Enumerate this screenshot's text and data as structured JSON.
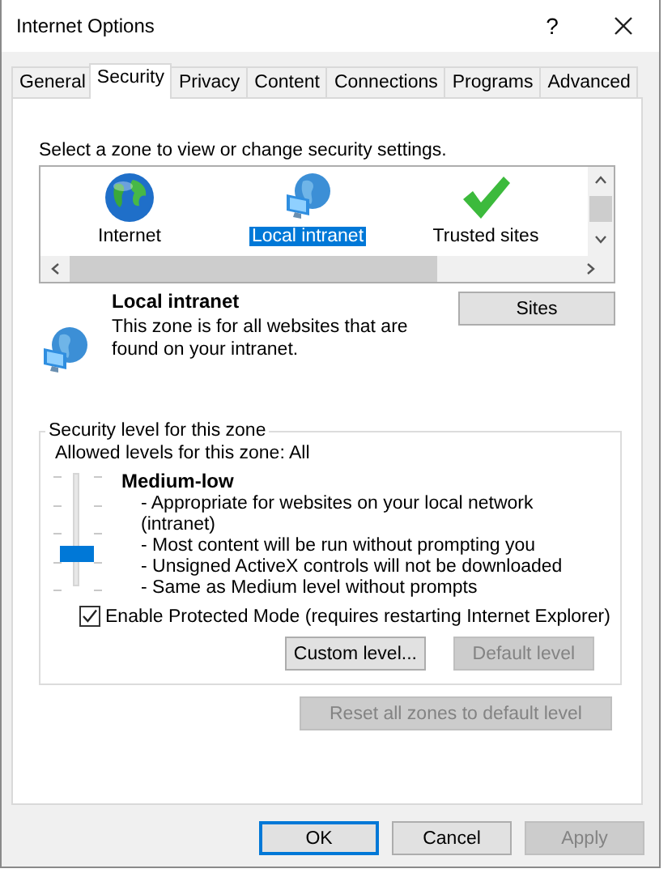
{
  "window": {
    "title": "Internet Options",
    "help": "?"
  },
  "tabs": [
    {
      "label": "General",
      "selected": false
    },
    {
      "label": "Security",
      "selected": true
    },
    {
      "label": "Privacy",
      "selected": false
    },
    {
      "label": "Content",
      "selected": false
    },
    {
      "label": "Connections",
      "selected": false
    },
    {
      "label": "Programs",
      "selected": false
    },
    {
      "label": "Advanced",
      "selected": false
    }
  ],
  "zones": {
    "prompt": "Select a zone to view or change security settings.",
    "items": [
      {
        "label": "Internet",
        "kind": "globe",
        "selected": false
      },
      {
        "label": "Local intranet",
        "kind": "intranet",
        "selected": true
      },
      {
        "label": "Trusted sites",
        "kind": "check",
        "selected": false
      }
    ]
  },
  "zone_info": {
    "kind": "intranet",
    "title": "Local intranet",
    "description": "This zone is for all websites that are found on your intranet.",
    "sites_button": "Sites"
  },
  "security_level": {
    "legend": "Security level for this zone",
    "allowed": "Allowed levels for this zone: All",
    "level": 0.25,
    "name": "Medium-low",
    "bullets": [
      "- Appropriate for websites on your local network (intranet)",
      "- Most content will be run without prompting you",
      "- Unsigned ActiveX controls will not be downloaded",
      "- Same as Medium level without prompts"
    ],
    "protected_mode": {
      "label": "Enable Protected Mode (requires restarting Internet Explorer)",
      "checked": true
    },
    "buttons": [
      {
        "label": "Custom level...",
        "disabled": false
      },
      {
        "label": "Default level",
        "disabled": true
      }
    ]
  },
  "reset_button": {
    "label": "Reset all zones to default level",
    "disabled": true
  },
  "buttons": [
    {
      "label": "OK",
      "disabled": false,
      "default": true
    },
    {
      "label": "Cancel",
      "disabled": false,
      "default": false
    },
    {
      "label": "Apply",
      "disabled": true,
      "default": false
    }
  ]
}
